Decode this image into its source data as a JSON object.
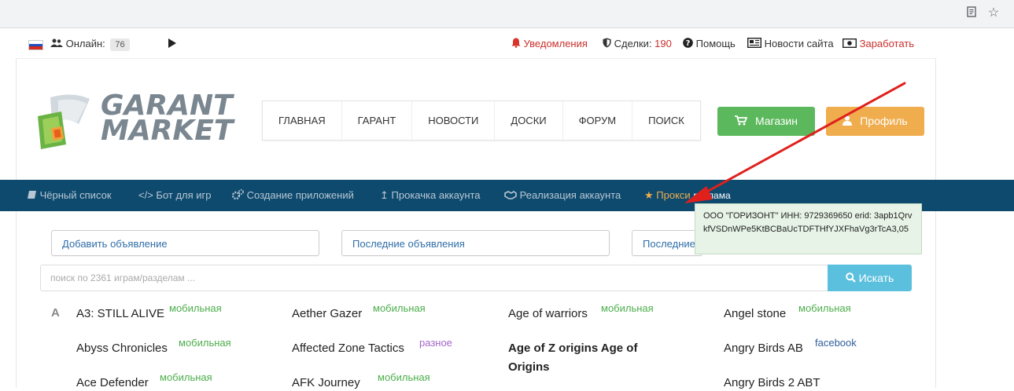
{
  "topbar": {
    "online_label": "Онлайн:",
    "online_count": "76",
    "notifications": "Уведомления",
    "deals_label": "Сделки:",
    "deals_count": "190",
    "help": "Помощь",
    "news": "Новости сайта",
    "earn": "Заработать"
  },
  "logo": {
    "line1": "GARANT",
    "line2": "MARKET"
  },
  "nav": [
    "ГЛАВНАЯ",
    "ГАРАНТ",
    "НОВОСТИ",
    "ДОСКИ",
    "ФОРУМ",
    "ПОИСК"
  ],
  "buttons": {
    "shop": "Магазин",
    "profile": "Профиль"
  },
  "subnav": {
    "blacklist": "Чёрный список",
    "bot": "Бот для игр",
    "apps": "Создание приложений",
    "boost": "Прокачка аккаунта",
    "sale": "Реализация аккаунта",
    "proxy": "Прокси",
    "ad_label": "реклама"
  },
  "tooltip": {
    "text": "ООО \"ГОРИЗОНТ\" ИНН: 9729369650 erid: 3apb1QrvkfVSDnWPe5KtBCBaUcTDFTHfYJXFhaVg3rTcA3,05"
  },
  "actions": {
    "add": "Добавить объявление",
    "last_ads": "Последние объявления",
    "last_partial": "Последние"
  },
  "search": {
    "placeholder": "поиск по 2361 играм/разделам ...",
    "button": "Искать"
  },
  "letter": "A",
  "games": [
    {
      "name": "A3: STILL ALIVE",
      "tag": "мобильная"
    },
    {
      "name": "Aether Gazer",
      "tag": "мобильная"
    },
    {
      "name": "Age of warriors",
      "tag": "мобильная"
    },
    {
      "name": "Angel stone",
      "tag": "мобильная"
    },
    {
      "name": "Abyss Chronicles",
      "tag": "мобильная"
    },
    {
      "name": "Affected Zone Tactics",
      "tag": "разное"
    },
    {
      "name": "Age of Z origins Age of Origins",
      "line1": "Age of Z origins Age of",
      "line2": "Origins",
      "tag": ""
    },
    {
      "name": "Angry Birds AB",
      "tag": "facebook"
    },
    {
      "name": "Ace Defender",
      "tag": "мобильная"
    },
    {
      "name": "AFK Journey",
      "tag": "мобильная"
    },
    {
      "name": "Angry Birds 2 ABT",
      "tag": ""
    }
  ],
  "colors": {
    "sub_nav_bg": "#0e4a6e",
    "shop_button": "#5cb85c",
    "profile_button": "#f0ad4e",
    "search_button": "#5bc0de",
    "proxy": "#f0ad4e",
    "notifications": "#d9342b",
    "arrow": "#e0201d"
  }
}
